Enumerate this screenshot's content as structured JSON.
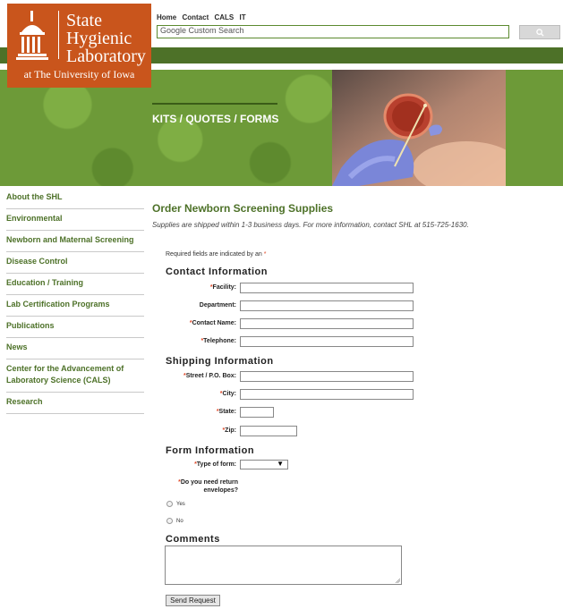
{
  "logo": {
    "line1": "State",
    "line2": "Hygienic",
    "line3": "Laboratory",
    "subtitle": "at The University of Iowa",
    "color": "#c9551c"
  },
  "top_links": [
    "Home",
    "Contact",
    "CALS",
    "IT"
  ],
  "search": {
    "placeholder": "Google Custom Search",
    "button_icon": "search-icon"
  },
  "banner": {
    "title": "KITS / QUOTES / FORMS"
  },
  "sidebar": {
    "items": [
      {
        "label": "About the SHL"
      },
      {
        "label": "Environmental"
      },
      {
        "label": "Newborn and Maternal Screening"
      },
      {
        "label": "Disease Control"
      },
      {
        "label": "Education / Training"
      },
      {
        "label": "Lab Certification Programs"
      },
      {
        "label": "Publications"
      },
      {
        "label": "News"
      },
      {
        "label": "Center for the Advancement of Laboratory Science (CALS)"
      },
      {
        "label": "Research"
      }
    ]
  },
  "main": {
    "title": "Order Newborn Screening Supplies",
    "intro": "Supplies are shipped within 1-3 business days. For more information, contact SHL at 515-725-1630.",
    "required_note": "Required fields are indicated by an",
    "required_marker": "*",
    "contact": {
      "heading": "Contact Information",
      "facility": "Facility:",
      "department": "Department:",
      "contact_name": "Contact Name:",
      "telephone": "Telephone:"
    },
    "shipping": {
      "heading": "Shipping Information",
      "street": "Street / P.O. Box:",
      "city": "City:",
      "state": "State:",
      "zip": "Zip:"
    },
    "form_info": {
      "heading": "Form Information",
      "type_label": "Type of form:",
      "type_value": "",
      "return_q": "Do you need return envelopes?",
      "yes": "Yes",
      "no": "No"
    },
    "comments": {
      "heading": "Comments",
      "value": ""
    },
    "send_label": "Send Request"
  },
  "colors": {
    "accent_green": "#4d7128",
    "link_green": "#4d7128",
    "required_red": "#e04a2a"
  }
}
